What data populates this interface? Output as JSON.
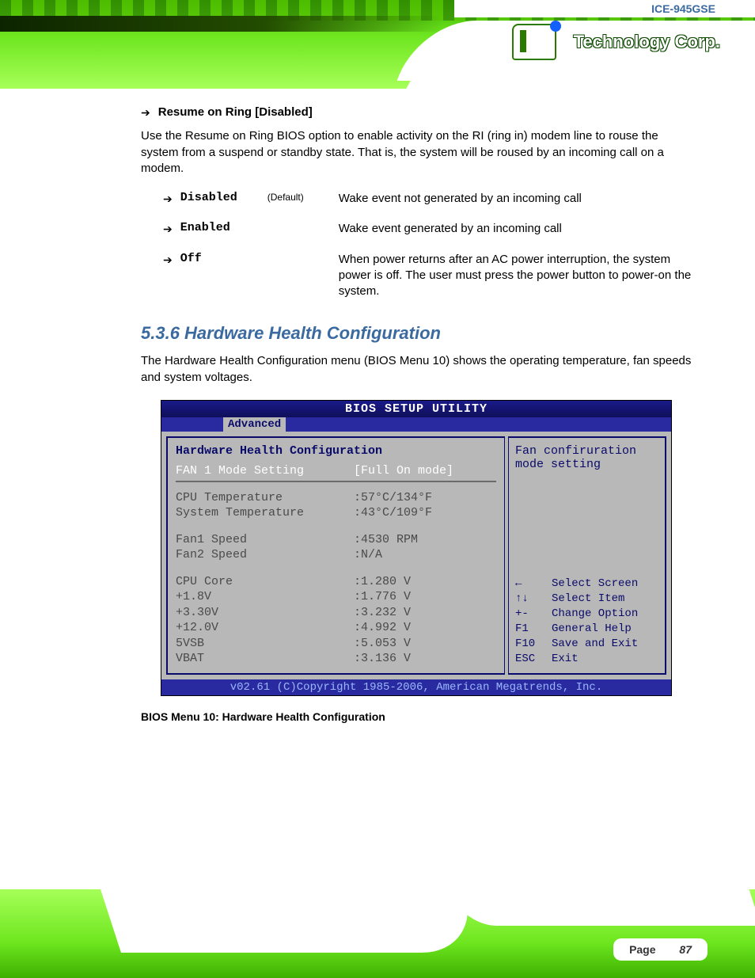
{
  "header": {
    "product": "ICE-945GSE",
    "brand_reg": "®",
    "brand_text": "Technology Corp."
  },
  "doc": {
    "resume_heading": "Resume on Ring [Disabled]",
    "resume_desc": "Use the Resume on Ring BIOS option to enable activity on the RI (ring in) modem line to rouse the system from a suspend or standby state. That is, the system will be roused by an incoming call on a modem.",
    "opt_disabled_lbl": "Disabled",
    "opt_disabled_def": "(Default)",
    "opt_disabled_desc": "Wake event not generated by an incoming call",
    "opt_enabled_lbl": "Enabled",
    "opt_enabled_desc": "Wake event generated by an incoming call",
    "opt_off_lbl": "Off",
    "opt_off_desc": "When power returns after an AC power interruption, the system power is off. The user must press the power button to power-on the system.",
    "section_heading": "5.3.6 Hardware Health Configuration",
    "section_desc": "The Hardware Health Configuration menu (BIOS Menu 10) shows the operating temperature, fan speeds and system voltages.",
    "caption": "BIOS Menu 10: Hardware Health Configuration"
  },
  "bios": {
    "title": "BIOS SETUP UTILITY",
    "tab": "Advanced",
    "heading": "Hardware Health Configuration",
    "sel_lbl": "FAN 1 Mode Setting",
    "sel_val": "[Full On mode]",
    "help_line1": "Fan confiruration",
    "help_line2": "mode setting",
    "rows": [
      {
        "lbl": "CPU Temperature",
        "val": ":57°C/134°F"
      },
      {
        "lbl": "System Temperature",
        "val": ":43°C/109°F"
      }
    ],
    "rows2": [
      {
        "lbl": "Fan1 Speed",
        "val": ":4530 RPM"
      },
      {
        "lbl": "Fan2 Speed",
        "val": ":N/A"
      }
    ],
    "rows3": [
      {
        "lbl": "CPU Core",
        "val": ":1.280 V"
      },
      {
        "lbl": "+1.8V",
        "val": ":1.776 V"
      },
      {
        "lbl": "+3.30V",
        "val": ":3.232 V"
      },
      {
        "lbl": "+12.0V",
        "val": ":4.992 V"
      },
      {
        "lbl": "5VSB",
        "val": ":5.053 V"
      },
      {
        "lbl": "VBAT",
        "val": ":3.136 V"
      }
    ],
    "nav": [
      {
        "k": "←",
        "d": "Select Screen"
      },
      {
        "k": "↑↓",
        "d": "Select Item"
      },
      {
        "k": "+-",
        "d": "Change Option"
      },
      {
        "k": "F1",
        "d": "General Help"
      },
      {
        "k": "F10",
        "d": "Save and Exit"
      },
      {
        "k": "ESC",
        "d": "Exit"
      }
    ],
    "foot": "v02.61 (C)Copyright 1985-2006, American Megatrends, Inc."
  },
  "footer": {
    "page_label": "Page",
    "page_no": "87"
  }
}
